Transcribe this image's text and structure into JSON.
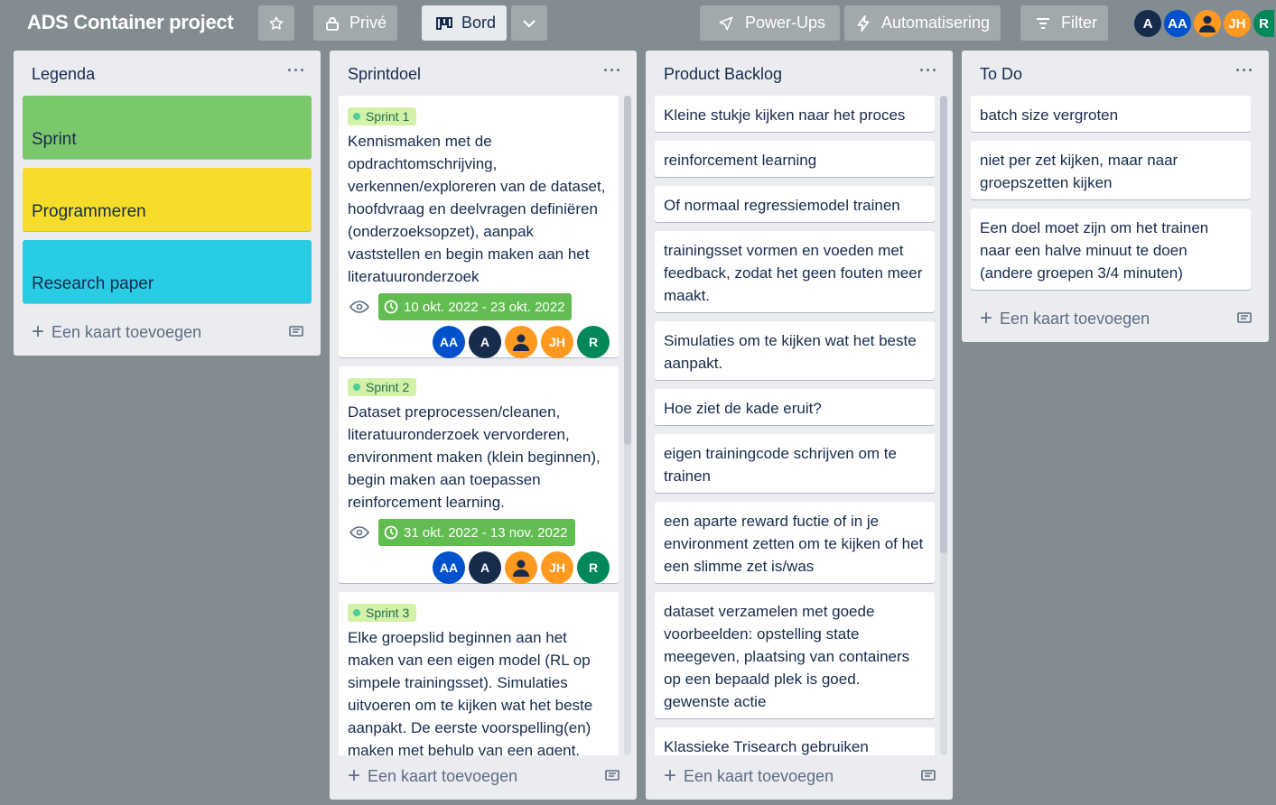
{
  "header": {
    "board_title": "ADS Container project",
    "visibility_label": "Privé",
    "view_label": "Bord",
    "power_ups_label": "Power-Ups",
    "automation_label": "Automatisering",
    "filter_label": "Filter",
    "avatars": [
      "A",
      "AA",
      "",
      "JH",
      "R"
    ]
  },
  "colors": {
    "board_bg": "#838c91",
    "green": "#7bc86c",
    "yellow": "#f5dd29",
    "cyan": "#29cce5",
    "due_green": "#61bd4f",
    "avatar_blue": "#0052cc",
    "avatar_navy": "#172b4d",
    "avatar_orange": "#ff991f",
    "avatar_teal": "#00875a"
  },
  "lists": {
    "legenda": {
      "title": "Legenda",
      "cards": [
        "Sprint",
        "Programmeren",
        "Research paper"
      ],
      "add_label": "Een kaart toevoegen"
    },
    "sprintdoel": {
      "title": "Sprintdoel",
      "cards": [
        {
          "label": "Sprint 1",
          "text": "Kennismaken met de opdrachtomschrijving, verkennen/exploreren van de dataset, hoofdvraag en deelvragen definiëren (onderzoeksopzet), aanpak vaststellen en begin maken aan het literatuuronderzoek",
          "due": "10 okt. 2022 - 23 okt. 2022",
          "members": [
            "AA",
            "A",
            "",
            "JH",
            "R"
          ]
        },
        {
          "label": "Sprint 2",
          "text": "Dataset preprocessen/cleanen, literatuuronderzoek vervorderen, environment maken (klein beginnen), begin maken aan toepassen reinforcement learning.",
          "due": "31 okt. 2022 - 13 nov. 2022",
          "members": [
            "AA",
            "A",
            "",
            "JH",
            "R"
          ]
        },
        {
          "label": "Sprint 3",
          "text": "Elke groepslid beginnen aan het maken van een eigen model (RL op simpele trainingsset). Simulaties uitvoeren om te kijken wat het beste aanpakt. De eerste voorspelling(en) maken met behulp van een agent."
        }
      ],
      "add_label": "Een kaart toevoegen"
    },
    "backlog": {
      "title": "Product Backlog",
      "cards": [
        "Kleine stukje kijken naar het proces",
        "reinforcement learning",
        "Of normaal regressiemodel trainen",
        "trainingsset vormen en voeden met feedback, zodat het geen fouten meer maakt.",
        "Simulaties om te kijken wat het beste aanpakt.",
        "Hoe ziet de kade eruit?",
        "eigen trainingcode schrijven om te trainen",
        "een aparte reward fuctie of in je environment zetten om te kijken of het een slimme zet is/was",
        "dataset verzamelen met goede voorbeelden: opstelling state meegeven, plaatsing van containers op een bepaald plek is goed. gewenste actie",
        "Klassieke Trisearch gebruiken"
      ],
      "add_label": "Een kaart toevoegen"
    },
    "todo": {
      "title": "To Do",
      "cards": [
        "batch size vergroten",
        "niet per zet kijken, maar naar groepszetten kijken",
        "Een doel moet zijn om het trainen naar een halve minuut te doen (andere groepen 3/4 minuten)"
      ],
      "add_label": "Een kaart toevoegen"
    }
  }
}
